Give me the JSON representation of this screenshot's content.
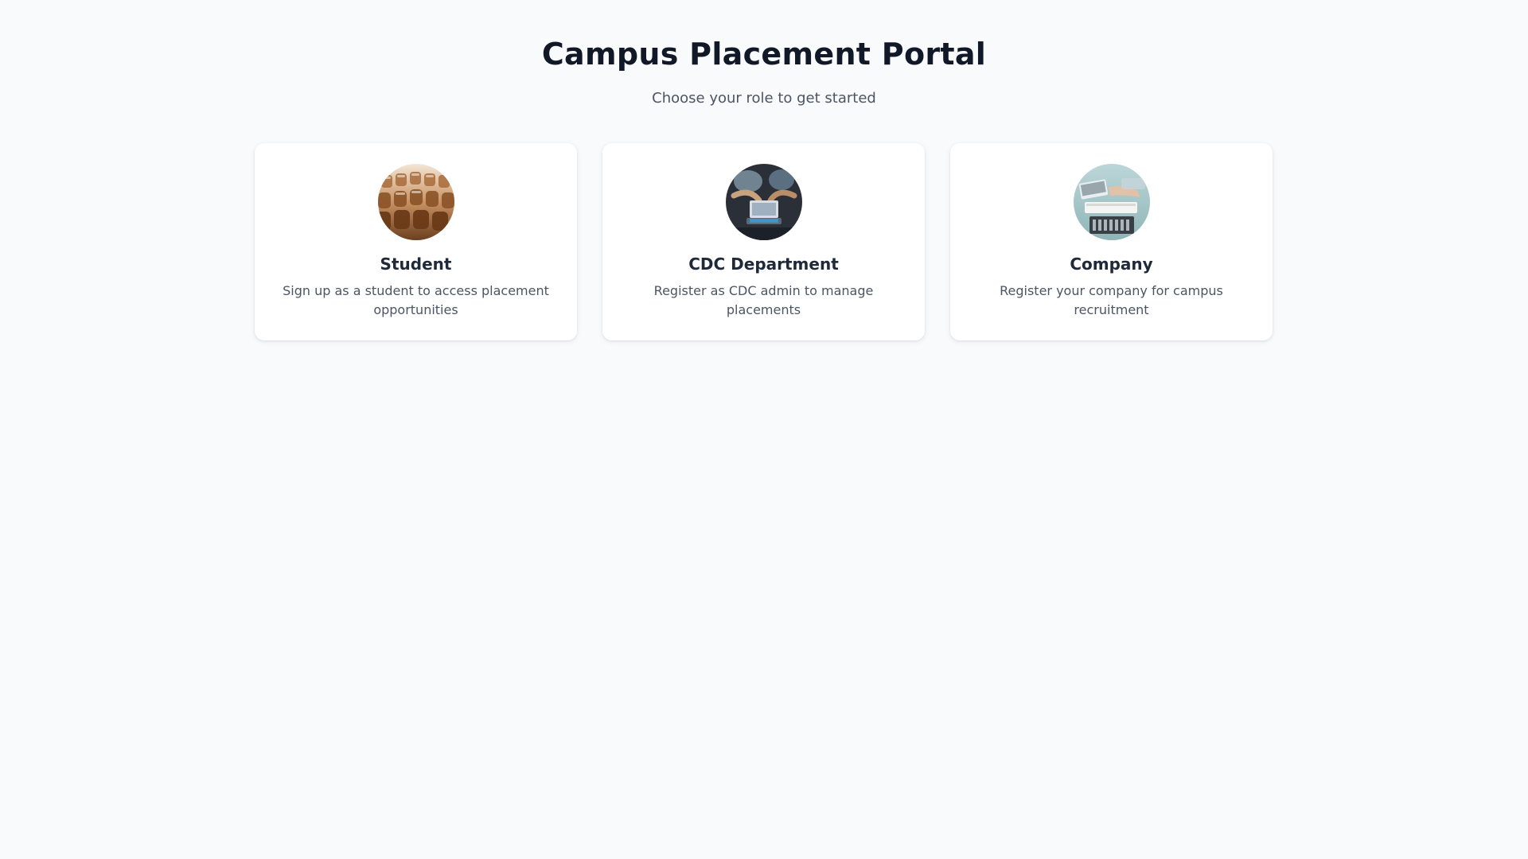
{
  "header": {
    "title": "Campus Placement Portal",
    "subtitle": "Choose your role to get started"
  },
  "roles": [
    {
      "title": "Student",
      "description": "Sign up as a student to access placement opportunities",
      "image_icon": "lecture-hall-seats-photo"
    },
    {
      "title": "CDC Department",
      "description": "Register as CDC admin to manage placements",
      "image_icon": "team-with-laptop-photo"
    },
    {
      "title": "Company",
      "description": "Register your company for campus recruitment",
      "image_icon": "business-meeting-laptop-photo"
    }
  ],
  "colors": {
    "background": "#f8fafc",
    "card": "#ffffff",
    "title": "#111827",
    "text_muted": "#4b5563"
  }
}
